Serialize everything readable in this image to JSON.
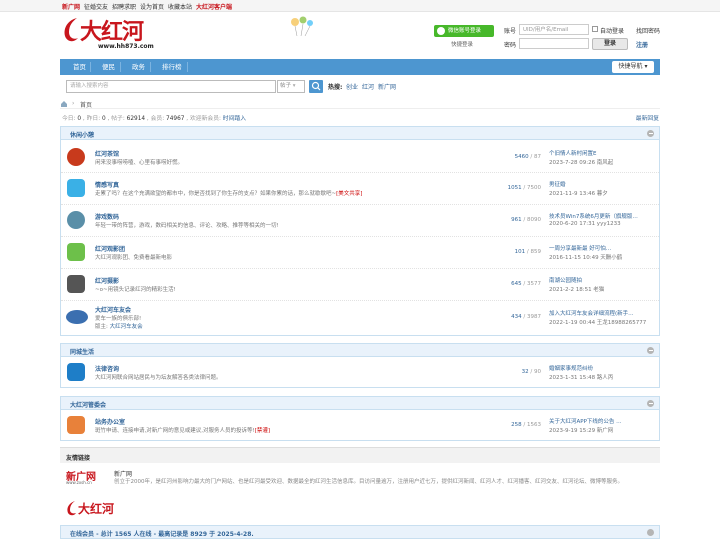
{
  "topbar": {
    "links": [
      "新广网",
      "征婚交友",
      "招聘求职",
      "设为首页",
      "收藏本站",
      "大红河客户端"
    ]
  },
  "header": {
    "logo_text": "大红河",
    "logo_url": "www.hh873.com",
    "wechat_login": "微信账号登录",
    "quick_login": "快捷登录",
    "account_label": "账号",
    "account_placeholder": "UID/用户名/Email",
    "auto_login": "自动登录",
    "forgot_password": "找回密码",
    "password_label": "密码",
    "login_button": "登录",
    "register": "注册"
  },
  "nav": {
    "items": [
      "首页",
      "便民",
      "政务",
      "排行榜"
    ],
    "quick_nav": "快捷导航"
  },
  "search": {
    "placeholder": "请输入搜索内容",
    "type": "帖子",
    "hot_label": "热搜:",
    "hot_links": [
      "创业",
      "红河",
      "新广网"
    ]
  },
  "breadcrumb": {
    "current": "首页"
  },
  "stats": {
    "today_label": "今日:",
    "today": "0",
    "yesterday_label": "昨日:",
    "yesterday": "0",
    "posts_label": "帖子:",
    "posts": "62914",
    "members_label": "会员:",
    "members": "74967",
    "welcome_label": "欢迎新会员:",
    "new_member": "时间踏入",
    "recent_replies": "最新回复"
  },
  "categories": [
    {
      "title": "休闲小憩",
      "forums": [
        {
          "name": "红河茶馆",
          "desc": "闲来没事唠唠嗑、心里有事唠好慌。",
          "threads": "5460",
          "posts": "87",
          "last_title": "个旧情人新村闲置E",
          "last_meta": "2023-7-28 09:26 南风起",
          "icon_color": "#c83a1c"
        },
        {
          "name": "情感写真",
          "desc": "走累了吗？在这个充满欲望的都市中，你是否找到了你生存的支点？如果你累的话，那么就歇歇吧~",
          "desc_red": "[美文共享]",
          "threads": "1051",
          "posts": "7500",
          "last_title": "男征婚",
          "last_meta": "2021-11-9 13:46 暮夕",
          "icon_color": "#3ab0e6"
        },
        {
          "name": "游戏数码",
          "desc": "年轻一带的阵营，游戏，数码相关的信息、评论、攻略、推荐等相关的一切!",
          "threads": "961",
          "posts": "8090",
          "last_title": "技术员Win7系统6月更新（旗舰版…",
          "last_meta": "2020-6-20 17:31 yyy1233",
          "icon_color": "#5a8fa8"
        },
        {
          "name": "红河观影团",
          "desc": "大红河观影团、免费看最新电影",
          "threads": "101",
          "posts": "859",
          "last_title": "一周分享最新最 好可怕…",
          "last_meta": "2016-11-15 10:49 天酬小鹤",
          "icon_color": "#6dc04a"
        },
        {
          "name": "红河摄影",
          "desc": "~o~用镜头记录红河的精彩生活!",
          "threads": "645",
          "posts": "3577",
          "last_title": "南湖公园随拍",
          "last_meta": "2021-2-2 18:51 老猫",
          "icon_color": "#555"
        },
        {
          "name": "大红河车友会",
          "desc": "爱车一族的俱乐部!",
          "moderator_label": "版主:",
          "moderator": "大红河车友会",
          "threads": "434",
          "posts": "3987",
          "last_title": "加入大红河车友会详细流程(新手…",
          "last_meta": "2022-1-19 00:44 王龙18988265777",
          "icon_color": "#3b6fb0"
        }
      ]
    },
    {
      "title": "同城生活",
      "forums": [
        {
          "name": "法律咨询",
          "desc": "大红河网联合网站居民与为坛友解答各类法律问题。",
          "threads": "32",
          "posts": "90",
          "last_title": "婚姻家事规范纠纷",
          "last_meta": "2023-1-31 15:48 路人丙",
          "icon_color": "#1e7ec8"
        }
      ]
    },
    {
      "title": "大红河管委会",
      "forums": [
        {
          "name": "站务办公室",
          "desc": "斑竹申请、连接申请,对新广网的意见或建议,对服务人员的投诉等!",
          "desc_red": "[禁灌]",
          "threads": "258",
          "posts": "1563",
          "last_title": "关于大红河APP下线的公告 …",
          "last_meta": "2023-9-19 15:29 新广网",
          "icon_color": "#e8813a"
        }
      ]
    }
  ],
  "links": {
    "title": "友情链接",
    "site1_logo": "新广网",
    "site1_logo_sub": "www.zxsh.cn",
    "site1_name": "新广网",
    "site1_desc": "创立于2000年，是红河州影响力最大的门户网站、也是红河最受欢迎、数据最全的红河生活信息库。目访问量逾万，注册用户近七万，提供红河新闻、红河人才、红河播客、红河交友、红河论坛、微博等服务。",
    "site2_logo": "大红河"
  },
  "online": {
    "text": "在线会员 - 总计 1565 人在线 - 最高记录是 8929 于 2025-4-28."
  },
  "colors": {
    "accent": "#4d96d0",
    "link": "#336699",
    "brand_red": "#c8161d"
  }
}
